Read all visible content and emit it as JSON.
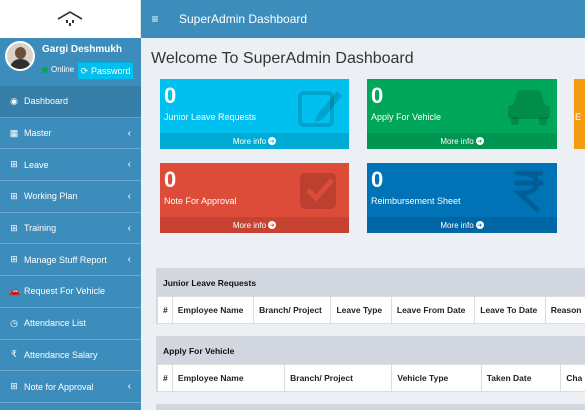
{
  "user": {
    "name": "Gargi Deshmukh",
    "status": "Online",
    "password_button": "Password"
  },
  "header": {
    "title": "SuperAdmin Dashboard"
  },
  "sidebar": {
    "items": [
      {
        "label": "Dashboard",
        "icon": "dashboard-icon",
        "glyph": "◉",
        "chevron": false
      },
      {
        "label": "Master",
        "icon": "table-icon",
        "glyph": "▦",
        "chevron": true
      },
      {
        "label": "Leave",
        "icon": "plus-square-icon",
        "glyph": "⊞",
        "chevron": true
      },
      {
        "label": "Working Plan",
        "icon": "plus-square-icon",
        "glyph": "⊞",
        "chevron": true
      },
      {
        "label": "Training",
        "icon": "plus-square-icon",
        "glyph": "⊞",
        "chevron": true
      },
      {
        "label": "Manage Stuff Report",
        "icon": "plus-square-icon",
        "glyph": "⊞",
        "chevron": true
      },
      {
        "label": "Request For Vehicle",
        "icon": "car-icon",
        "glyph": "🚗",
        "chevron": false
      },
      {
        "label": "Attendance List",
        "icon": "clock-icon",
        "glyph": "◷",
        "chevron": false
      },
      {
        "label": "Attendance Salary",
        "icon": "rupee-icon",
        "glyph": "₹",
        "chevron": false
      },
      {
        "label": "Note for Approval",
        "icon": "plus-square-icon",
        "glyph": "⊞",
        "chevron": true
      }
    ],
    "chevron_glyph": "‹"
  },
  "main": {
    "welcome": "Welcome To SuperAdmin Dashboard",
    "more_info": "More info",
    "boxes": [
      {
        "count": "0",
        "label": "Junior Leave Requests",
        "color": "#00c0ef",
        "icon": "edit-icon"
      },
      {
        "count": "0",
        "label": "Apply For Vehicle",
        "color": "#00a65a",
        "icon": "car-icon"
      },
      {
        "count": "0",
        "label": "E",
        "color": "#f39c12",
        "icon": ""
      },
      {
        "count": "0",
        "label": "Note For Approval",
        "color": "#dd4b39",
        "icon": "check-square-icon"
      },
      {
        "count": "0",
        "label": "Reimbursement Sheet",
        "color": "#0073b7",
        "icon": "rupee-icon"
      }
    ],
    "tables": [
      {
        "title": "Junior Leave Requests",
        "columns": [
          "#",
          "Employee Name",
          "Branch/ Project",
          "Leave Type",
          "Leave From Date",
          "Leave To Date",
          "Reason"
        ]
      },
      {
        "title": "Apply For Vehicle",
        "columns": [
          "#",
          "Employee Name",
          "Branch/ Project",
          "Vehicle Type",
          "Taken Date",
          "Cha"
        ]
      }
    ]
  }
}
